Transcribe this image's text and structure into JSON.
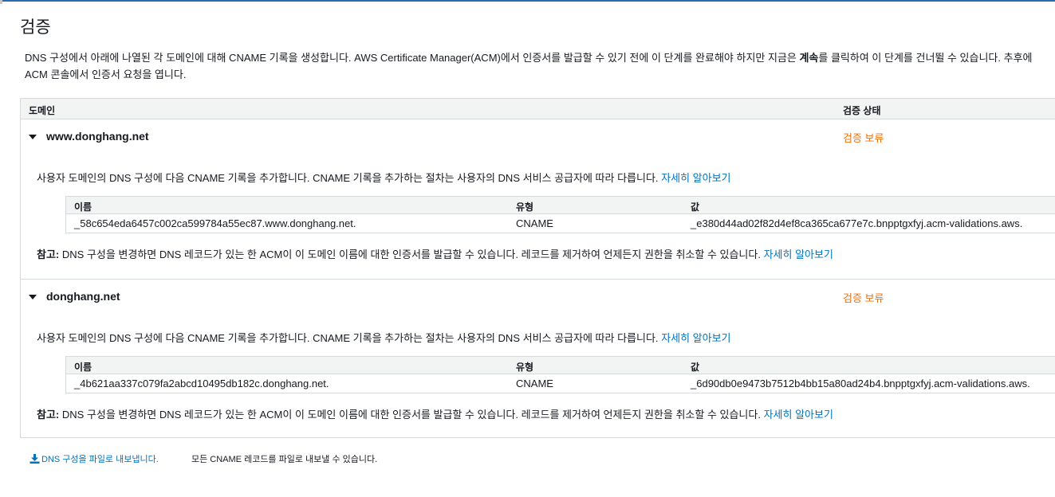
{
  "title": "검증",
  "description": {
    "line1_before": "DNS 구성에서 아래에 나열된 각 도메인에 대해 CNAME 기록을 생성합니다. AWS Certificate Manager(ACM)에서 인증서를 발급할 수 있기 전에 이 단계를 완료해야 하지만 지금은 ",
    "line1_bold": "계속",
    "line1_after": "를 클릭하여 이 단계를 건너뛸 수 있습니다. 추후에",
    "line2": "ACM 콘솔에서 인증서 요청을 엽니다."
  },
  "table": {
    "col_domain": "도메인",
    "col_status": "검증 상태"
  },
  "domains": [
    {
      "name": "www.donghang.net",
      "status": "검증 보류",
      "instruction": "사용자 도메인의 DNS 구성에 다음 CNAME 기록을 추가합니다. CNAME 기록을 추가하는 절차는 사용자의 DNS 서비스 공급자에 따라 다릅니다.",
      "instruction_link": "자세히 알아보기",
      "record_headers": {
        "name": "이름",
        "type": "유형",
        "value": "값"
      },
      "record": {
        "name": "_58c654eda6457c002ca599784a55ec87.www.donghang.net.",
        "type": "CNAME",
        "value": "_e380d44ad02f82d4ef8ca365ca677e7c.bnpptgxfyj.acm-validations.aws."
      },
      "note_label": "참고:",
      "note": " DNS 구성을 변경하면 DNS 레코드가 있는 한 ACM이 이 도메인 이름에 대한 인증서를 발급할 수 있습니다. 레코드를 제거하여 언제든지 권한을 취소할 수 있습니다.",
      "note_link": "자세히 알아보기"
    },
    {
      "name": "donghang.net",
      "status": "검증 보류",
      "instruction": "사용자 도메인의 DNS 구성에 다음 CNAME 기록을 추가합니다. CNAME 기록을 추가하는 절차는 사용자의 DNS 서비스 공급자에 따라 다릅니다.",
      "instruction_link": "자세히 알아보기",
      "record_headers": {
        "name": "이름",
        "type": "유형",
        "value": "값"
      },
      "record": {
        "name": "_4b621aa337c079fa2abcd10495db182c.donghang.net.",
        "type": "CNAME",
        "value": "_6d90db0e9473b7512b4bb15a80ad24b4.bnpptgxfyj.acm-validations.aws."
      },
      "note_label": "참고:",
      "note": " DNS 구성을 변경하면 DNS 레코드가 있는 한 ACM이 이 도메인 이름에 대한 인증서를 발급할 수 있습니다. 레코드를 제거하여 언제든지 권한을 취소할 수 있습니다.",
      "note_link": "자세히 알아보기"
    }
  ],
  "export": {
    "link_label": "DNS 구성을 파일로 내보냅니다.",
    "description": "모든 CNAME 레코드를 파일로 내보낼 수 있습니다.",
    "icon": "download-icon"
  },
  "colors": {
    "link": "#0073bb",
    "pending_status": "#ec7211",
    "header_bg": "#f2f3f3",
    "border": "#d5dbdb"
  }
}
